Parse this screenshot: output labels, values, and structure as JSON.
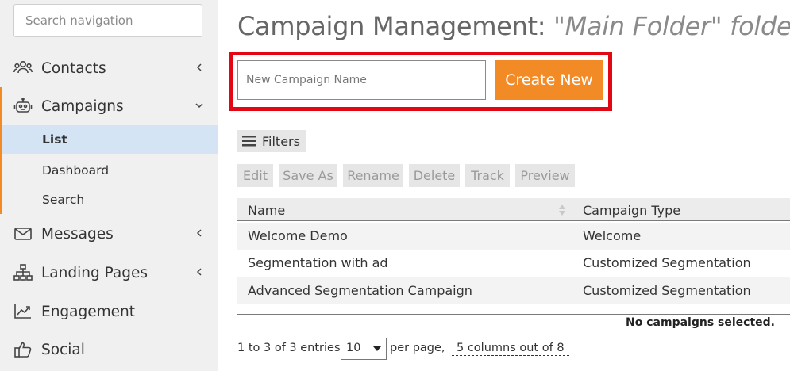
{
  "sidebar": {
    "search_placeholder": "Search navigation",
    "items": [
      {
        "label": "Contacts",
        "icon": "users-icon"
      },
      {
        "label": "Campaigns",
        "icon": "robot-icon"
      },
      {
        "label": "Messages",
        "icon": "envelope-icon"
      },
      {
        "label": "Landing Pages",
        "icon": "sitemap-icon"
      },
      {
        "label": "Engagement",
        "icon": "chart-line-icon"
      },
      {
        "label": "Social",
        "icon": "thumbs-up-icon"
      }
    ],
    "campaign_subitems": [
      {
        "label": "List",
        "active": true
      },
      {
        "label": "Dashboard"
      },
      {
        "label": "Search"
      }
    ],
    "accent_color": "#f28a26",
    "active_bg": "#d5e4f5"
  },
  "header": {
    "title": "Campaign Management:",
    "folder": "\"Main Folder\" folder"
  },
  "create": {
    "placeholder": "New Campaign Name",
    "button_label": "Create New",
    "button_color": "#f28a26",
    "highlight_color": "#e30613"
  },
  "toolbar": {
    "filters_label": "Filters",
    "actions": [
      "Edit",
      "Save As",
      "Rename",
      "Delete",
      "Track",
      "Preview"
    ]
  },
  "table": {
    "columns": [
      "Name",
      "Campaign Type"
    ],
    "rows": [
      {
        "name": "Welcome Demo",
        "type": "Welcome"
      },
      {
        "name": "Segmentation with ad",
        "type": "Customized Segmentation"
      },
      {
        "name": "Advanced Segmentation Campaign",
        "type": "Customized Segmentation"
      }
    ],
    "selection_status": "No campaigns selected."
  },
  "pager": {
    "entries_text": "1 to 3 of 3 entries,",
    "per_page_value": "10",
    "per_page_label": "per page,",
    "columns_text": "5 columns out of 8"
  }
}
